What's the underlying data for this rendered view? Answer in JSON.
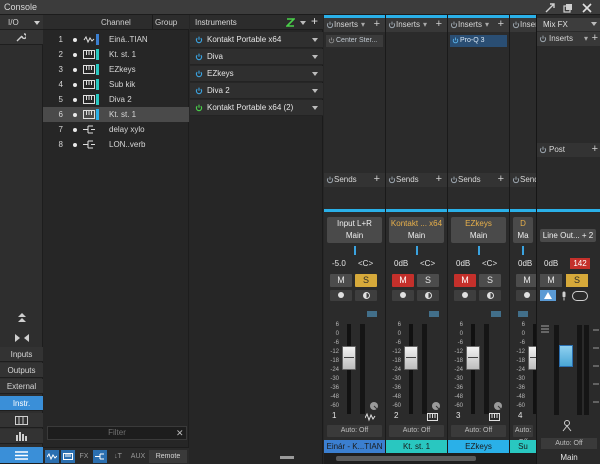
{
  "window": {
    "title": "Console"
  },
  "rail": {
    "io_label": "I/O",
    "buttons": [
      "Inputs",
      "Outputs",
      "External",
      "Instr."
    ]
  },
  "tracklist": {
    "col_channel": "Channel",
    "col_group": "Group",
    "rows": [
      {
        "num": "1",
        "name": "Einá..TIAN",
        "color": "#3b7fd0"
      },
      {
        "num": "2",
        "name": "Kt. st. 1",
        "color": "#29c7c0"
      },
      {
        "num": "3",
        "name": "EZkeys",
        "color": "#29c7c0"
      },
      {
        "num": "4",
        "name": "Sub kik",
        "color": "#29c7c0"
      },
      {
        "num": "5",
        "name": "Diva 2",
        "color": "#29c7c0"
      },
      {
        "num": "6",
        "name": "Kt. st. 1",
        "color": "#2ab0e8"
      },
      {
        "num": "7",
        "name": "delay xylo",
        "color": ""
      },
      {
        "num": "8",
        "name": "LON..verb",
        "color": ""
      }
    ],
    "filter_placeholder": "Filter",
    "bottom": {
      "aux": "AUX",
      "remote": "Remote"
    }
  },
  "instruments": {
    "title": "Instruments",
    "items": [
      "Kontakt Portable x64",
      "Diva",
      "EZkeys",
      "Diva 2",
      "Kontakt Portable x64 (2)"
    ]
  },
  "strips": [
    {
      "number": "1",
      "insert_slot": "Center Ster...",
      "input": "Input L+R",
      "output": "Main",
      "volume": "-5.0",
      "pan": "<C>",
      "mute_active": false,
      "solo_active": true,
      "automation": "Auto: Off",
      "name": "Einár - K...TIAN",
      "name_color": "#3b7fd0",
      "input_color": "#f0f0f0"
    },
    {
      "number": "2",
      "insert_slot": "",
      "input": "Kontakt ... x64",
      "output": "Main",
      "volume": "0dB",
      "pan": "<C>",
      "mute_active": true,
      "solo_active": false,
      "automation": "Auto: Off",
      "name": "Kt. st. 1",
      "name_color": "#29c7c0",
      "input_color": "#e8b04a"
    },
    {
      "number": "3",
      "insert_slot": "Pro-Q 3",
      "input": "EZkeys",
      "output": "Main",
      "volume": "0dB",
      "pan": "<C>",
      "mute_active": true,
      "solo_active": false,
      "automation": "Auto: Off",
      "name": "EZkeys",
      "name_color": "#2ab0e8",
      "input_color": "#e8b04a"
    },
    {
      "number": "4",
      "insert_slot": "",
      "input": "D",
      "output": "Ma",
      "volume": "0dB",
      "pan": "",
      "mute_active": false,
      "solo_active": false,
      "automation": "Auto: Off",
      "name": "Su",
      "name_color": "#29c7c0",
      "input_color": "#e8b04a"
    }
  ],
  "inserts_label": "Inserts",
  "sends_label": "Sends",
  "scale": [
    "6",
    "0",
    "-6",
    "-12",
    "-18",
    "-24",
    "-30",
    "-36",
    "-48",
    "-60"
  ],
  "mixfx": {
    "title": "Mix FX",
    "inserts": "Inserts",
    "post": "Post",
    "output": "Line Out... + 2",
    "volume": "0dB",
    "peak": "142",
    "automation": "Auto: Off",
    "name": "Main"
  }
}
